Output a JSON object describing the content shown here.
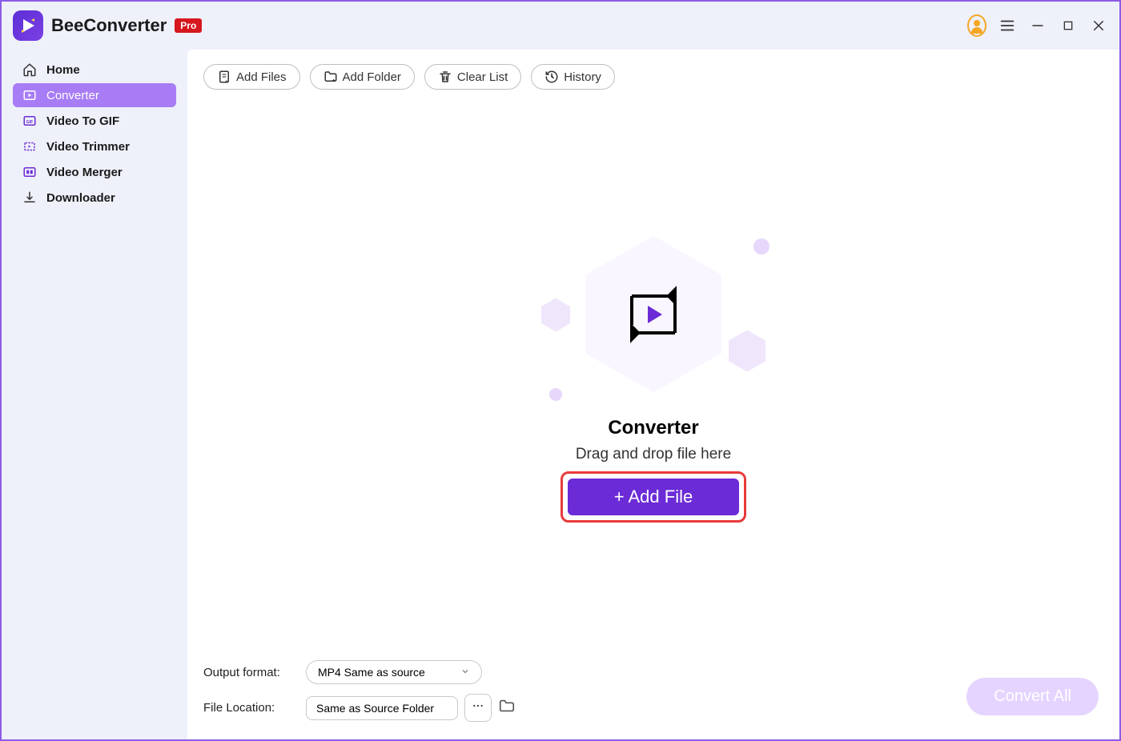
{
  "header": {
    "app_name": "BeeConverter",
    "pro_badge": "Pro"
  },
  "sidebar": {
    "items": [
      {
        "label": "Home",
        "icon": "home-icon",
        "active": false
      },
      {
        "label": "Converter",
        "icon": "converter-icon",
        "active": true
      },
      {
        "label": "Video To GIF",
        "icon": "video-to-gif-icon",
        "active": false
      },
      {
        "label": "Video Trimmer",
        "icon": "video-trimmer-icon",
        "active": false
      },
      {
        "label": "Video Merger",
        "icon": "video-merger-icon",
        "active": false
      },
      {
        "label": "Downloader",
        "icon": "downloader-icon",
        "active": false
      }
    ]
  },
  "toolbar": {
    "add_files": "Add Files",
    "add_folder": "Add Folder",
    "clear_list": "Clear List",
    "history": "History"
  },
  "stage": {
    "title": "Converter",
    "subtitle": "Drag and drop file here",
    "add_file_button": "+ Add File"
  },
  "footer": {
    "output_format_label": "Output format:",
    "output_format_value": "MP4 Same as source",
    "file_location_label": "File Location:",
    "file_location_value": "Same as Source Folder",
    "convert_all": "Convert All"
  }
}
